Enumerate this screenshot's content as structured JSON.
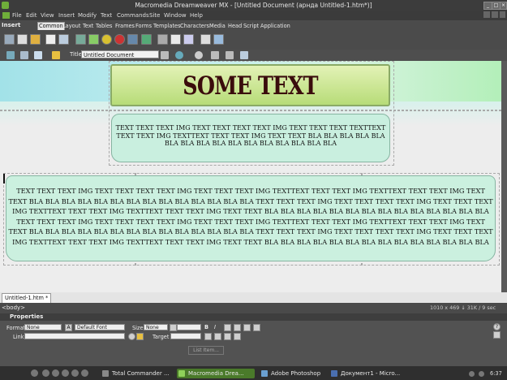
{
  "window": {
    "title": "Macromedia Dreamweaver MX - [Untitled Document (арнда Untitled-1.htm*)]"
  },
  "menu": [
    "File",
    "Edit",
    "View",
    "Insert",
    "Modify",
    "Text",
    "Commands",
    "Site",
    "Window",
    "Help"
  ],
  "insert_bar": {
    "label": "Insert",
    "tabs": [
      "Common",
      "Layout",
      "Text",
      "Tables",
      "Frames",
      "Forms",
      "Templates",
      "Characters",
      "Media",
      "Head",
      "Script",
      "Application"
    ],
    "active_tab": "Common"
  },
  "doc_toolbar": {
    "title_label": "Title:",
    "title_value": "Untitled Document"
  },
  "document": {
    "banner_text": "SOME TEXT",
    "box1_text": "TEXT TEXT TEXT IMG TEXT TEXT TEXT TEXT IMG TEXT TEXT TEXT TEXTTEXT TEXT TEXT IMG TEXTTEXT TEXT TEXT IMG TEXT TEXT BLA BLA BLA BLA BLA BLA BLA BLA BLA BLA BLA BLA BLA BLA BLA BLA",
    "box2_text": "TEXT TEXT TEXT IMG TEXT TEXT TEXT TEXT IMG TEXT TEXT TEXT IMG TEXTTEXT TEXT TEXT IMG TEXTTEXT TEXT TEXT IMG TEXT TEXT BLA BLA BLA BLA BLA BLA BLA BLA BLA BLA BLA BLA BLA BLA TEXT TEXT TEXT IMG TEXT TEXT TEXT TEXT IMG TEXT TEXT TEXT IMG TEXTTEXT TEXT TEXT IMG TEXTTEXT TEXT TEXT IMG TEXT TEXT BLA BLA BLA BLA BLA BLA BLA BLA BLA BLA BLA BLA BLA BLA TEXT TEXT TEXT IMG TEXT TEXT TEXT TEXT IMG TEXT TEXT TEXT IMG TEXTTEXT TEXT TEXT IMG TEXTTEXT TEXT TEXT IMG TEXT TEXT BLA BLA BLA BLA BLA BLA BLA BLA BLA BLA BLA BLA BLA BLA TEXT TEXT TEXT IMG TEXT TEXT TEXT TEXT IMG TEXT TEXT TEXT IMG TEXTTEXT TEXT TEXT IMG TEXTTEXT TEXT TEXT IMG TEXT TEXT BLA BLA BLA BLA BLA BLA BLA BLA BLA BLA BLA BLA BLA BLA"
  },
  "doc_tab": "Untitled-1.htm *",
  "status": {
    "tag": "<body>",
    "size": "1010 x 469 ↓ 31K / 9 sec"
  },
  "properties": {
    "label": "Properties",
    "format_label": "Format",
    "format_value": "None",
    "font_value": "Default Font",
    "size_label": "Size",
    "size_value": "None",
    "bold": "B",
    "italic": "I",
    "link_label": "Link",
    "target_label": "Target",
    "list_item": "List Item..."
  },
  "taskbar": {
    "tasks": [
      "Total Commander ...",
      "Macromedia Drea...",
      "Adobe Photoshop",
      "Документ1 - Micro..."
    ],
    "active_task": 1,
    "clock": "6:37"
  },
  "colors": {
    "banner_text": "#3a0c0c",
    "box_fill": "#c9efdf",
    "banner_fill": "#c8e696",
    "active_task": "#4a7a2a"
  }
}
